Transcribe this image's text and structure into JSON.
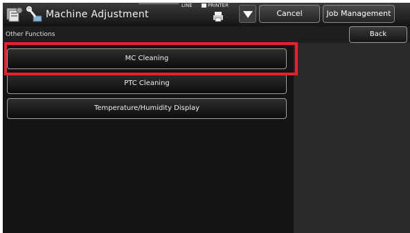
{
  "header": {
    "title": "Machine Adjustment",
    "line_label": "LINE",
    "printer_label": "PRINTER",
    "cancel_label": "Cancel",
    "job_management_label": "Job Management"
  },
  "section": {
    "title": "Other Functions",
    "back_label": "Back"
  },
  "functions": [
    {
      "label": "MC Cleaning",
      "highlighted": true
    },
    {
      "label": "PTC Cleaning",
      "highlighted": false
    },
    {
      "label": "Temperature/Humidity Display",
      "highlighted": false
    }
  ],
  "colors": {
    "highlight": "#e8202a",
    "background": "#2a2a2a"
  }
}
